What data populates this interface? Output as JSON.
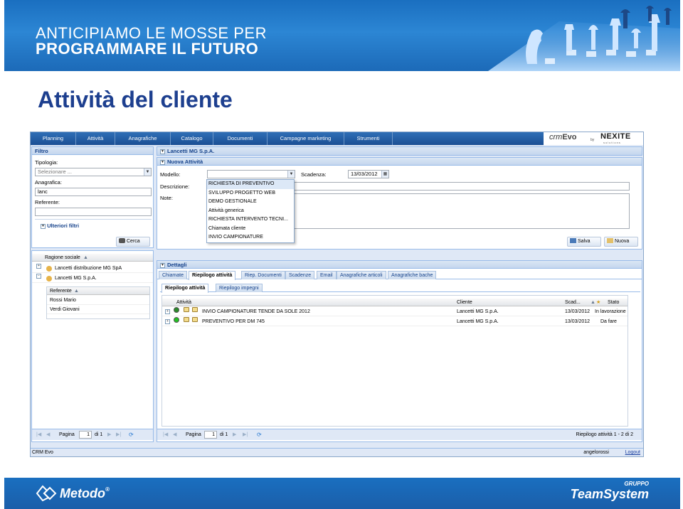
{
  "banner": {
    "line1": "ANTICIPIAMO LE MOSSE PER",
    "line2": "PROGRAMMARE IL FUTURO"
  },
  "slide_title": "Attività del cliente",
  "app": {
    "menu": [
      "Planning",
      "Attività",
      "Anagrafiche",
      "Catalogo",
      "Documenti",
      "Campagne marketing",
      "Strumenti"
    ],
    "logo": {
      "crm_prefix": "crm",
      "crm_suffix": "Evo",
      "by": "by",
      "company": "NEXITE",
      "tagline": "solutions"
    },
    "filter": {
      "title": "Filtro",
      "tipologia_label": "Tipologia:",
      "tipologia_placeholder": "Selezionare ...",
      "anagrafica_label": "Anagrafica:",
      "anagrafica_value": "lanc",
      "referente_label": "Referente:",
      "referente_value": "",
      "more_filters": "Ulteriori filtri",
      "search_button": "Cerca"
    },
    "client_list": {
      "header": "Ragione sociale",
      "rows": [
        "Lancetti distribuzione MG SpA",
        "Lancetti MG S.p.A."
      ],
      "referente_header": "Referente",
      "referenti": [
        "Rossi Mario",
        "Verdi Giovani"
      ],
      "pager": {
        "page_label": "Pagina",
        "page": "1",
        "of": "di 1"
      }
    },
    "customer_panel": {
      "title": "Lancetti MG S.p.A."
    },
    "new_activity": {
      "title": "Nuova Attività",
      "modello_label": "Modello:",
      "scadenza_label": "Scadenza:",
      "scadenza_value": "13/03/2012",
      "descrizione_label": "Descrizione:",
      "note_label": "Note:",
      "save_button": "Salva",
      "new_button": "Nuova",
      "dropdown_options": [
        "RICHIESTA DI PREVENTIVO",
        "SVILUPPO PROGETTO WEB",
        "DEMO GESTIONALE",
        "Attività generica",
        "RICHIESTA INTERVENTO TECNI...",
        "Chiamata cliente",
        "INVIO CAMPIONATURE"
      ]
    },
    "details": {
      "title": "Dettagli",
      "tabs": [
        "Chiamate",
        "Riepilogo attività",
        "Riep. Documenti",
        "Scadenze",
        "Email",
        "Anagrafiche articoli",
        "Anagrafiche bache"
      ],
      "subtabs": [
        "Riepilogo attività",
        "Riepilogo impegni"
      ],
      "columns": {
        "attivita": "Attività",
        "cliente": "Cliente",
        "scadenza": "Scad...",
        "stato": "Stato"
      },
      "rows": [
        {
          "attivita": "INVIO CAMPIONATURE TENDE DA SOLE 2012",
          "cliente": "Lancetti MG S.p.A.",
          "scadenza": "13/03/2012",
          "stato": "In lavorazione",
          "dot_color": "#2a8a2a"
        },
        {
          "attivita": "PREVENTIVO PER DM 745",
          "cliente": "Lancetti MG S.p.A.",
          "scadenza": "13/03/2012",
          "stato": "Da fare",
          "dot_color": "#22c022"
        }
      ],
      "pager": {
        "page_label": "Pagina",
        "page": "1",
        "of": "di 1",
        "summary": "Riepilogo attività 1 - 2 di 2"
      }
    },
    "statusbar": {
      "app_name": "CRM Evo",
      "user": "angelorossi",
      "logout": "Logout"
    }
  },
  "footer": {
    "metodo": "Metodo",
    "registered": "®",
    "gruppo": "GRUPPO",
    "teamsystem": "TeamSystem"
  },
  "colors": {
    "banner_blue": "#1a6fc0",
    "title_blue": "#1d3f8f",
    "panel_head": "#15428b"
  }
}
